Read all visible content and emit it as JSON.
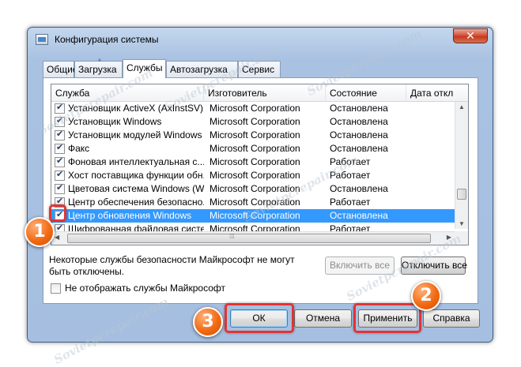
{
  "window": {
    "title": "Конфигурация системы",
    "close_label": "✕"
  },
  "tabs": [
    {
      "label": "Общие"
    },
    {
      "label": "Загрузка"
    },
    {
      "label": "Службы",
      "active": true
    },
    {
      "label": "Автозагрузка"
    },
    {
      "label": "Сервис"
    }
  ],
  "columns": {
    "service": "Служба",
    "manufacturer": "Изготовитель",
    "state": "Состояние",
    "disabled_date": "Дата откл"
  },
  "services": [
    {
      "checked": true,
      "name": "Установщик ActiveX (AxInstSV)",
      "manufacturer": "Microsoft Corporation",
      "state": "Остановлена"
    },
    {
      "checked": true,
      "name": "Установщик Windows",
      "manufacturer": "Microsoft Corporation",
      "state": "Остановлена"
    },
    {
      "checked": true,
      "name": "Установщик модулей Windows",
      "manufacturer": "Microsoft Corporation",
      "state": "Остановлена"
    },
    {
      "checked": true,
      "name": "Факс",
      "manufacturer": "Microsoft Corporation",
      "state": "Остановлена"
    },
    {
      "checked": true,
      "name": "Фоновая интеллектуальная с...",
      "manufacturer": "Microsoft Corporation",
      "state": "Работает"
    },
    {
      "checked": true,
      "name": "Хост поставщика функции обн...",
      "manufacturer": "Microsoft Corporation",
      "state": "Работает"
    },
    {
      "checked": true,
      "name": "Цветовая система Windows (W...",
      "manufacturer": "Microsoft Corporation",
      "state": "Остановлена"
    },
    {
      "checked": true,
      "name": "Центр обеспечения безопасно...",
      "manufacturer": "Microsoft Corporation",
      "state": "Работает"
    },
    {
      "checked": true,
      "name": "Центр обновления Windows",
      "manufacturer": "Microsoft Corporation",
      "state": "Остановлена",
      "selected": true
    },
    {
      "checked": true,
      "name": "Шифрованная файловая систе...",
      "manufacturer": "Microsoft Corporation",
      "state": "Работает"
    }
  ],
  "note": "Некоторые службы безопасности Майкрософт не могут быть отключены.",
  "buttons": {
    "enable_all": "Включить все",
    "disable_all": "Отключить все",
    "ok": "ОК",
    "cancel": "Отмена",
    "apply": "Применить",
    "help": "Справка"
  },
  "hide_ms_label": "Не отображать службы Майкрософт",
  "annotations": {
    "step1": "1",
    "step2": "2",
    "step3": "3",
    "highlight_color": "#e23434",
    "badge_color": "#f26a12"
  },
  "watermark": "Sovietpcrepair.com",
  "colors": {
    "selection": "#3399ff",
    "window_frame": "#a6bfe0"
  }
}
